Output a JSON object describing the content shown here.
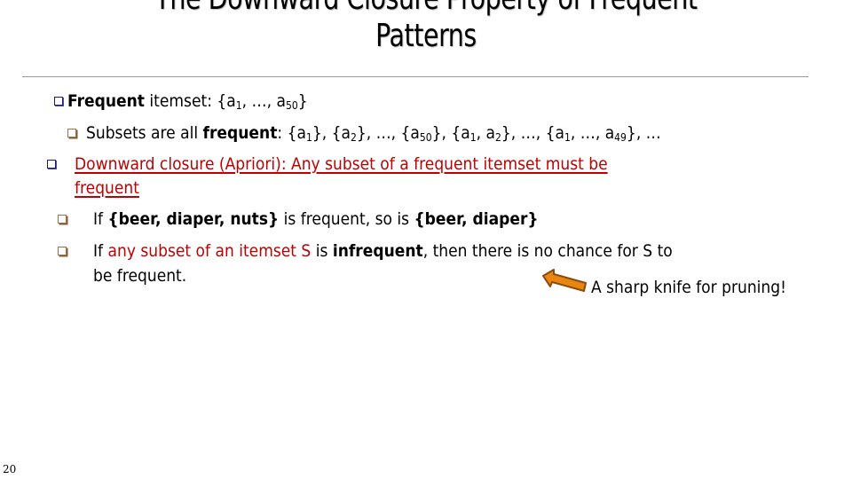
{
  "slide": {
    "title_line1": "The Downward Closure Property of Frequent",
    "title_line2": "Patterns",
    "page_number": "20"
  },
  "bullets": {
    "b1": {
      "bold": "Frequent",
      "text": " itemset:  {a",
      "sub1": "1",
      "mid": ", …, a",
      "sub2": "50",
      "end": "}"
    },
    "b1_1": {
      "pre": "Subsets are all ",
      "bold": "frequent",
      "post": ": {a",
      "s1": "1",
      "t1": "}, {a",
      "s2": "2",
      "t2": "}, …, {a",
      "s3": "50",
      "t3": "}, {a",
      "s4": "1",
      "t4": ", a",
      "s5": "2",
      "t5": "}, …, {a",
      "s6": "1",
      "t6": ", …, a",
      "s7": "49",
      "t7": "}, …"
    },
    "b2": {
      "line1": "Downward closure (Apriori):  Any subset of a frequent itemset must be",
      "line2": "frequent"
    },
    "b2_1": {
      "pre": "If ",
      "bold1": "{beer, diaper, nuts}",
      "mid": " is frequent, so is ",
      "bold2": "{beer, diaper}"
    },
    "b2_2": {
      "pre": "If ",
      "red": "any subset of an itemset S",
      "mid": " is ",
      "bold": "infrequent",
      "post": ", then there is no chance for S to",
      "line2": "be frequent."
    }
  },
  "callout": {
    "text": "A sharp knife for pruning!",
    "arrow_icon": "arrow-up-left-icon",
    "arrow_fill": "#e8860f",
    "arrow_stroke": "#8a4a10"
  },
  "colors": {
    "bullet_level1": "#1a1a8c",
    "bullet_level2": "#a0704a",
    "emphasis_red": "#c00000"
  }
}
